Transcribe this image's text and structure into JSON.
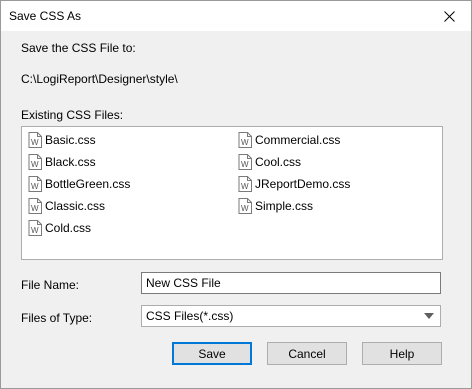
{
  "window": {
    "title": "Save CSS As",
    "close_icon": "close-icon"
  },
  "save_to": {
    "label": "Save the CSS File to:",
    "path": "C:\\LogiReport\\Designer\\style\\"
  },
  "existing": {
    "label": "Existing CSS Files:",
    "icon": "css-file-icon",
    "files": [
      "Basic.css",
      "Black.css",
      "BottleGreen.css",
      "Classic.css",
      "Cold.css",
      "Commercial.css",
      "Cool.css",
      "JReportDemo.css",
      "Simple.css"
    ]
  },
  "file_name": {
    "label": "File Name:",
    "value": "New CSS File"
  },
  "file_type": {
    "label": "Files of Type:",
    "value": "CSS Files(*.css)"
  },
  "buttons": {
    "save": "Save",
    "cancel": "Cancel",
    "help": "Help"
  },
  "colors": {
    "dialog_bg": "#f0f0f0",
    "focus_border": "#0078d7"
  }
}
